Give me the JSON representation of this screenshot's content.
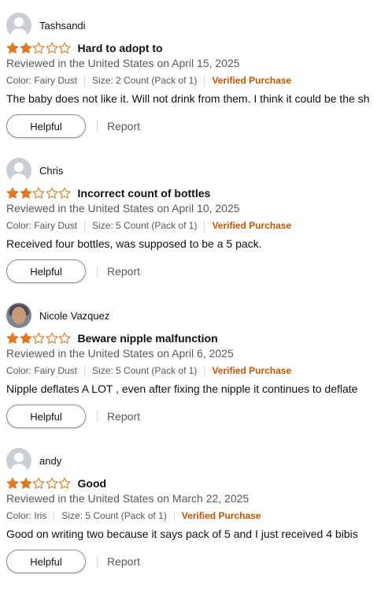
{
  "reviews": [
    {
      "name": "Tashsandi",
      "avatar": "default-avatar-icon",
      "rating": 2,
      "max_rating": 5,
      "title": "Hard to adopt to",
      "date": "Reviewed in the United States on April 15, 2025",
      "color": "Color: Fairy Dust",
      "size": "Size: 2 Count (Pack of 1)",
      "verified": "Verified Purchase",
      "body": "The baby does not like it. Will not drink from them. I think it could be the sh",
      "helpful": "Helpful",
      "report": "Report"
    },
    {
      "name": "Chris",
      "avatar": "default-avatar-icon",
      "rating": 2,
      "max_rating": 5,
      "title": "Incorrect count of bottles",
      "date": "Reviewed in the United States on April 10, 2025",
      "color": "Color: Fairy Dust",
      "size": "Size: 5 Count (Pack of 1)",
      "verified": "Verified Purchase",
      "body": "Received four bottles, was supposed to be a 5 pack.",
      "helpful": "Helpful",
      "report": "Report"
    },
    {
      "name": "Nicole Vazquez",
      "avatar": "profile-photo",
      "rating": 2,
      "max_rating": 5,
      "title": "Beware nipple malfunction",
      "date": "Reviewed in the United States on April 6, 2025",
      "color": "Color: Fairy Dust",
      "size": "Size: 5 Count (Pack of 1)",
      "verified": "Verified Purchase",
      "body": "Nipple deflates A LOT , even after fixing the nipple it continues to deflate",
      "helpful": "Helpful",
      "report": "Report"
    },
    {
      "name": "andy",
      "avatar": "default-avatar-icon",
      "rating": 2,
      "max_rating": 5,
      "title": "Good",
      "date": "Reviewed in the United States on March 22, 2025",
      "color": "Color: Iris",
      "size": "Size: 5 Count (Pack of 1)",
      "verified": "Verified Purchase",
      "body": "Good on writing two because it says pack of 5 and I just received 4 bibis",
      "helpful": "Helpful",
      "report": "Report"
    }
  ],
  "colors": {
    "star": "#de7921",
    "verified": "#c45500",
    "muted": "#565959"
  }
}
